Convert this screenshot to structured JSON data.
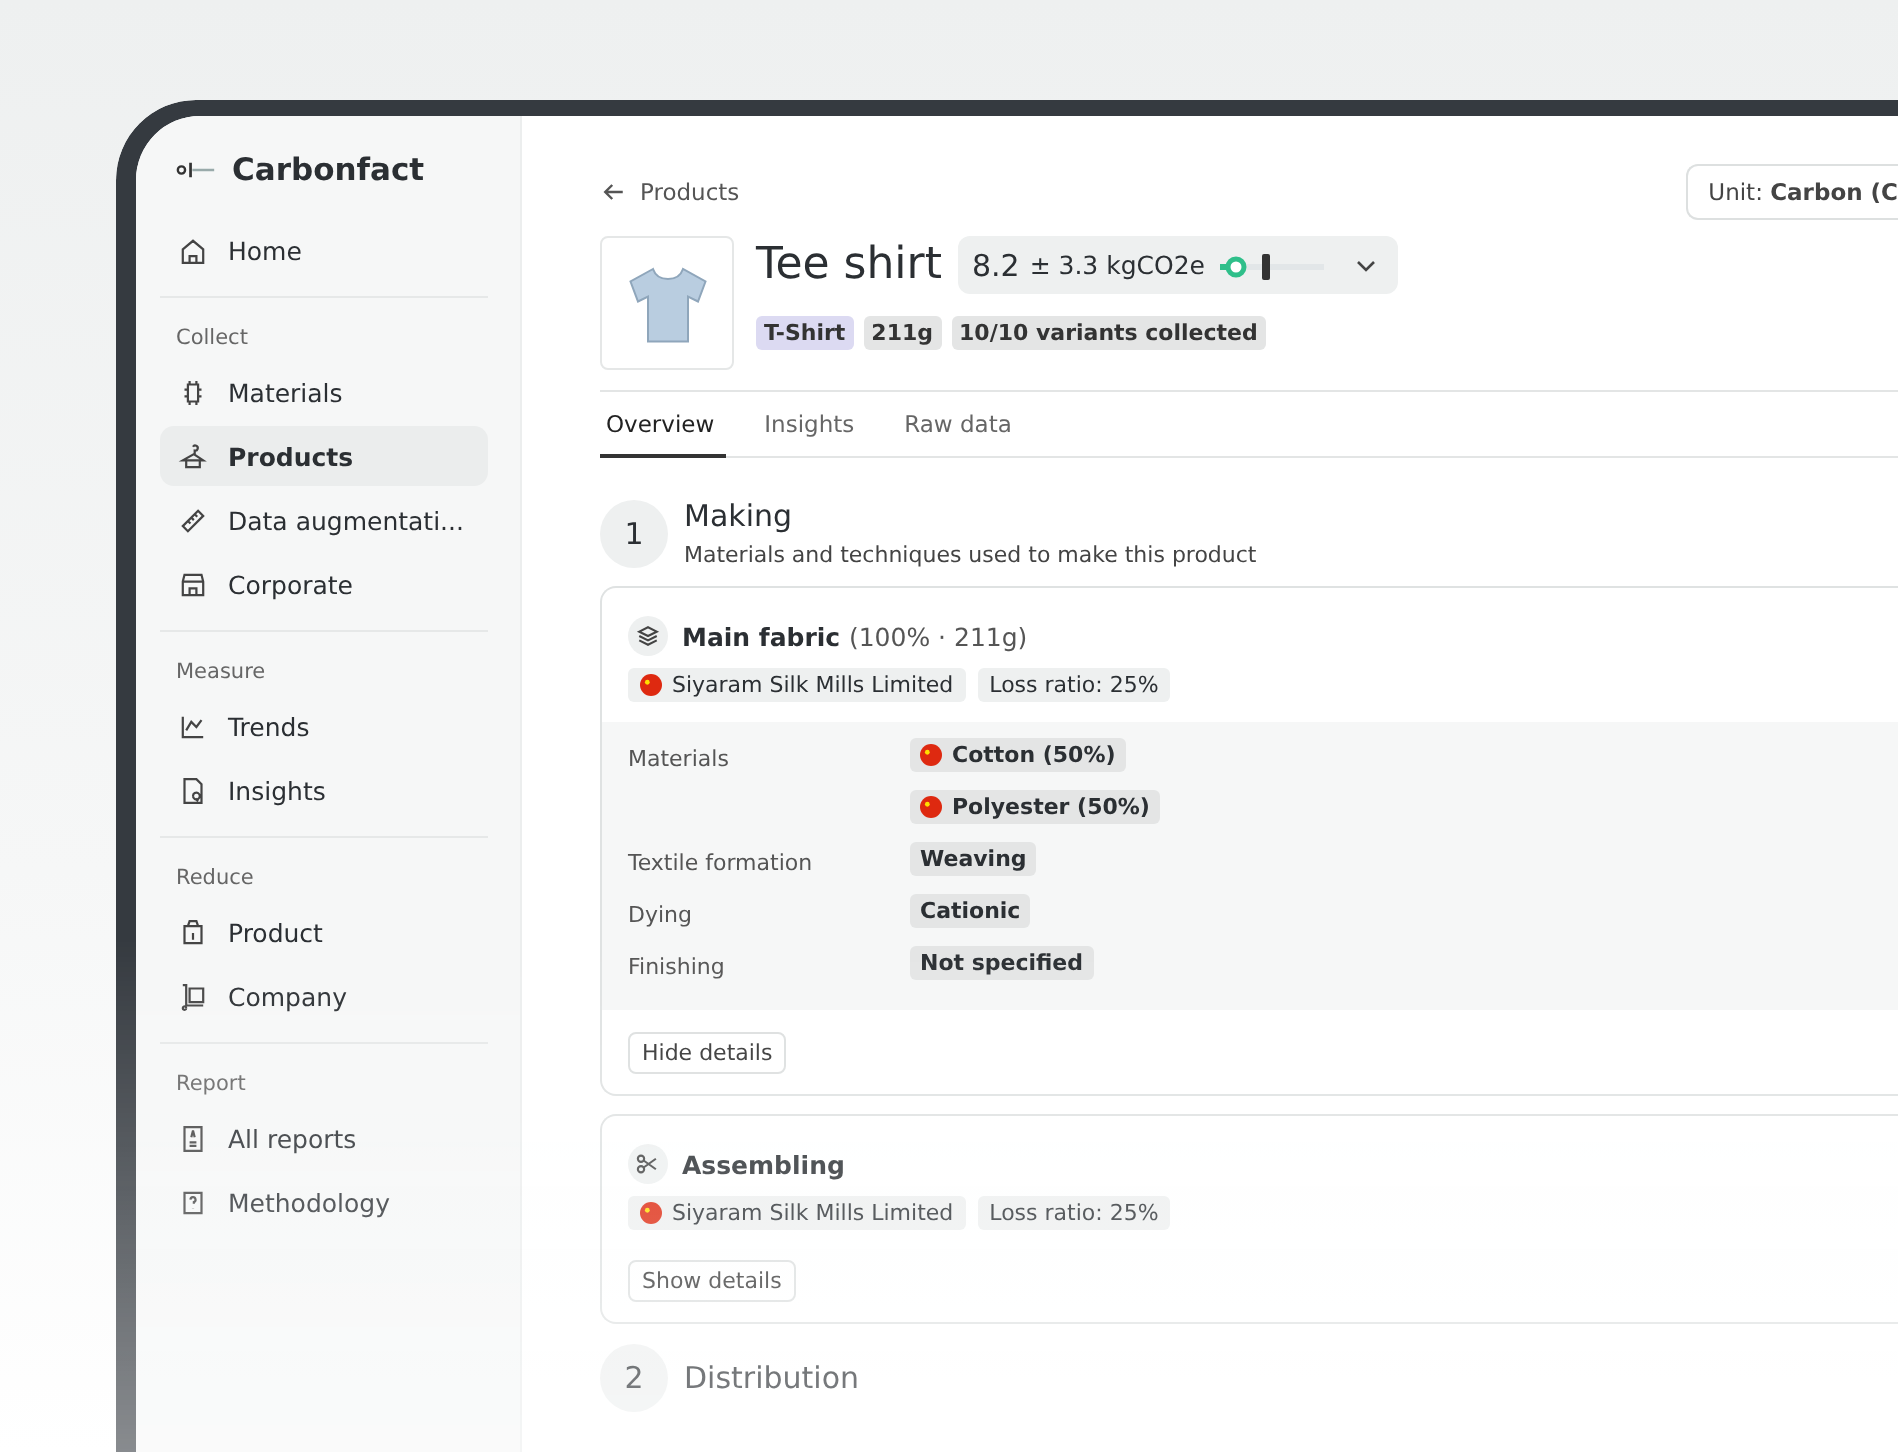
{
  "brand": {
    "name": "Carbonfact"
  },
  "sidebar": {
    "items": [
      {
        "label": "Home",
        "selected": false
      }
    ],
    "sections": [
      {
        "label": "Collect",
        "items": [
          {
            "label": "Materials",
            "selected": false
          },
          {
            "label": "Products",
            "selected": true
          },
          {
            "label": "Data augmentati...",
            "selected": false
          },
          {
            "label": "Corporate",
            "selected": false
          }
        ]
      },
      {
        "label": "Measure",
        "items": [
          {
            "label": "Trends",
            "selected": false
          },
          {
            "label": "Insights",
            "selected": false
          }
        ]
      },
      {
        "label": "Reduce",
        "items": [
          {
            "label": "Product",
            "selected": false
          },
          {
            "label": "Company",
            "selected": false
          }
        ]
      },
      {
        "label": "Report",
        "items": [
          {
            "label": "All reports",
            "selected": false
          },
          {
            "label": "Methodology",
            "selected": false
          }
        ]
      }
    ]
  },
  "breadcrumb": {
    "label": "Products"
  },
  "unit_selector": {
    "label": "Unit:",
    "value": "Carbon (C"
  },
  "product": {
    "title": "Tee shirt",
    "emission": {
      "value": "8.2",
      "uncertainty": "± 3.3 kgCO2e"
    },
    "tags": [
      {
        "label": "T-Shirt",
        "kind": "category"
      },
      {
        "label": "211g",
        "kind": "info"
      },
      {
        "label": "10/10 variants collected",
        "kind": "info"
      }
    ]
  },
  "tabs": [
    {
      "label": "Overview",
      "selected": true
    },
    {
      "label": "Insights",
      "selected": false
    },
    {
      "label": "Raw data",
      "selected": false
    }
  ],
  "steps": [
    {
      "number": "1",
      "title": "Making",
      "description": "Materials and techniques used to make this product",
      "cards": [
        {
          "title": "Main fabric",
          "detail": "(100% · 211g)",
          "supplier": "Siyaram Silk Mills Limited",
          "loss": "Loss ratio: 25%",
          "expanded": true,
          "toggle": "Hide details",
          "details": [
            {
              "label": "Materials",
              "values": [
                {
                  "text": "Cotton (50%)",
                  "flag": true
                },
                {
                  "text": "Polyester (50%)",
                  "flag": true
                }
              ]
            },
            {
              "label": "Textile formation",
              "values": [
                {
                  "text": "Weaving",
                  "flag": false
                }
              ]
            },
            {
              "label": "Dying",
              "values": [
                {
                  "text": "Cationic",
                  "flag": false
                }
              ]
            },
            {
              "label": "Finishing",
              "values": [
                {
                  "text": "Not specified",
                  "flag": false
                }
              ]
            }
          ]
        },
        {
          "title": "Assembling",
          "supplier": "Siyaram Silk Mills Limited",
          "loss": "Loss ratio: 25%",
          "expanded": false,
          "toggle": "Show details"
        }
      ]
    },
    {
      "number": "2",
      "title": "Distribution"
    }
  ]
}
